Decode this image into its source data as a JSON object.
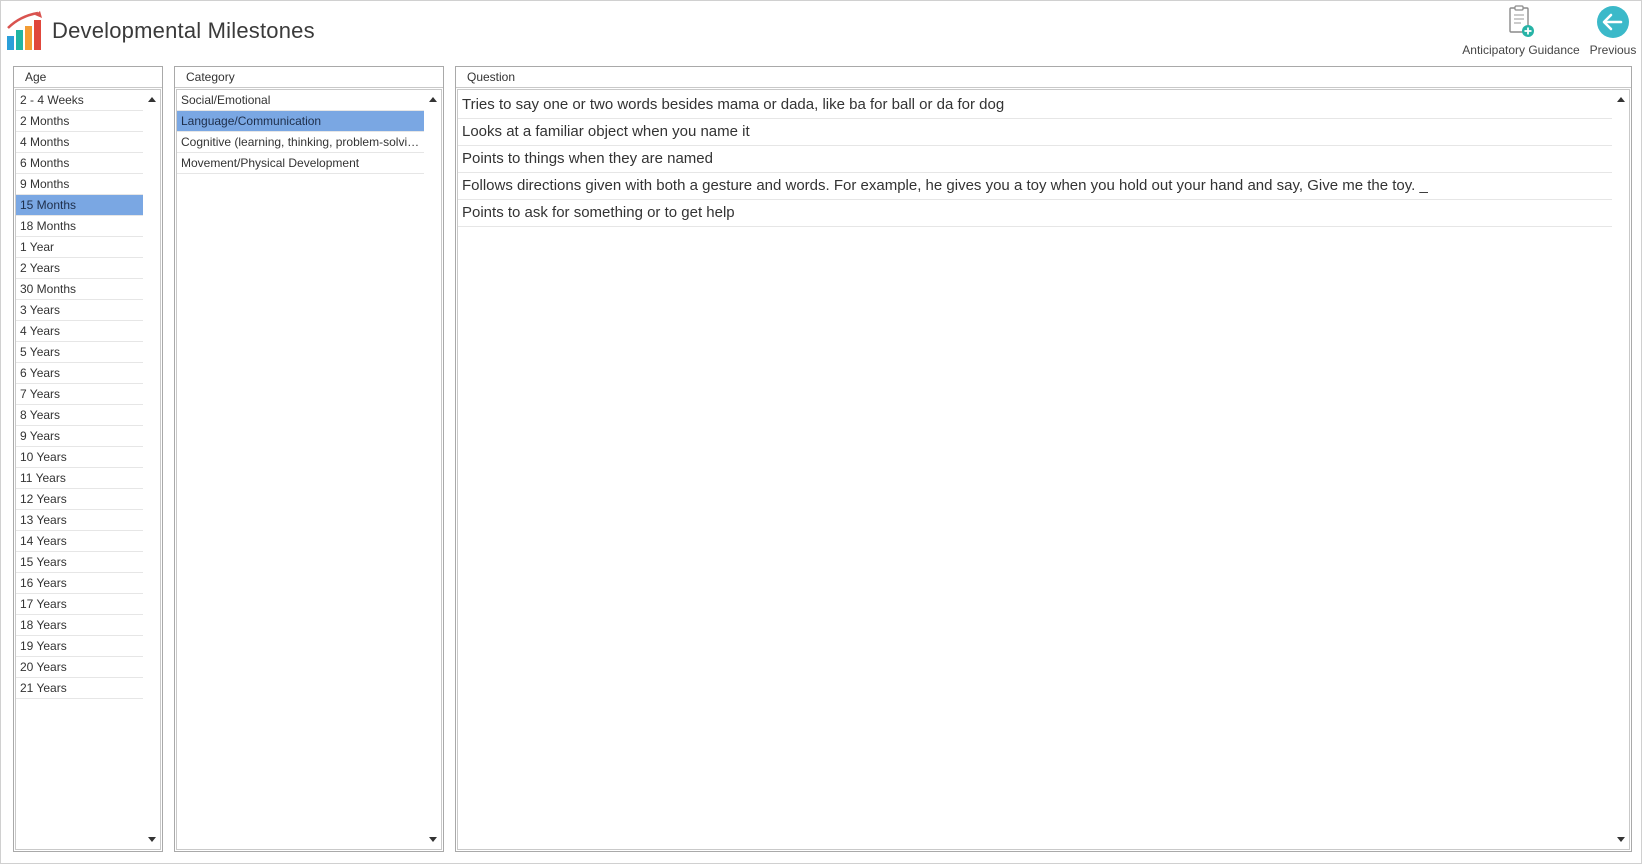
{
  "app": {
    "title": "Developmental Milestones",
    "logo_icon": "bar-chart-trend-icon",
    "colors": {
      "bar_blue": "#2b9fd9",
      "bar_teal": "#1fb5a3",
      "bar_orange": "#f39c34",
      "bar_red": "#e0473c",
      "trend": "#d9534f"
    }
  },
  "toolbar": {
    "guidance_label": "Anticipatory Guidance",
    "guidance_icon": "clipboard-add-icon",
    "previous_label": "Previous",
    "previous_icon": "arrow-left-circle-icon",
    "previous_color": "#3bb9c9"
  },
  "age_panel": {
    "header": "Age",
    "selected_color": "#7aa7e3",
    "items": [
      "2 - 4 Weeks",
      "2 Months",
      "4 Months",
      "6 Months",
      "9 Months",
      "15 Months",
      "18 Months",
      "1 Year",
      "2 Years",
      "30 Months",
      "3 Years",
      "4 Years",
      "5 Years",
      "6 Years",
      "7 Years",
      "8 Years",
      "9 Years",
      "10 Years",
      "11 Years",
      "12 Years",
      "13 Years",
      "14 Years",
      "15 Years",
      "16 Years",
      "17 Years",
      "18 Years",
      "19 Years",
      "20 Years",
      "21 Years"
    ],
    "selected": "15 Months"
  },
  "category_panel": {
    "header": "Category",
    "items": [
      "Social/Emotional",
      "Language/Communication",
      "Cognitive (learning, thinking, problem-solving)",
      "Movement/Physical Development"
    ],
    "selected": "Language/Communication"
  },
  "question_panel": {
    "header": "Question",
    "items": [
      "Tries to say one or two words besides mama or dada, like ba for ball or da for dog",
      "Looks at a familiar object when you name it",
      "Points to things when they are named",
      "Follows directions given with both a gesture and words. For example, he gives you a toy when you hold out your hand and say, Give me the toy. _",
      "Points to ask for something or to get help"
    ]
  }
}
